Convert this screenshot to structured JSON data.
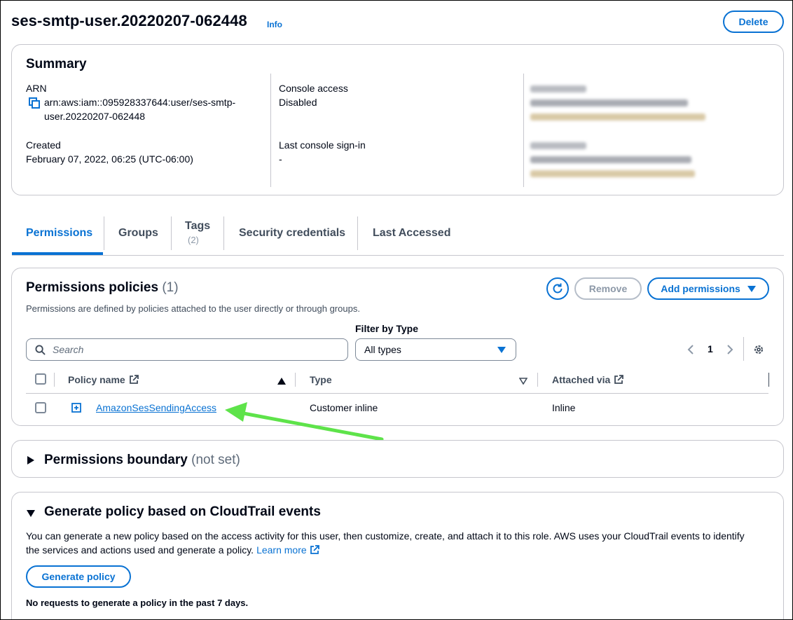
{
  "header": {
    "title": "ses-smtp-user.20220207-062448",
    "info_label": "Info",
    "delete_label": "Delete"
  },
  "summary": {
    "heading": "Summary",
    "arn_label": "ARN",
    "arn_value_line1": "arn:aws:iam::095928337644:user/ses-smtp-",
    "arn_value_line2": "user.20220207-062448",
    "created_label": "Created",
    "created_value": "February 07, 2022, 06:25 (UTC-06:00)",
    "console_access_label": "Console access",
    "console_access_value": "Disabled",
    "last_signin_label": "Last console sign-in",
    "last_signin_value": "-"
  },
  "tabs": [
    {
      "label": "Permissions",
      "active": true
    },
    {
      "label": "Groups"
    },
    {
      "label": "Tags",
      "count": "(2)"
    },
    {
      "label": "Security credentials"
    },
    {
      "label": "Last Accessed"
    }
  ],
  "policies": {
    "heading": "Permissions policies",
    "count": "(1)",
    "description": "Permissions are defined by policies attached to the user directly or through groups.",
    "remove_label": "Remove",
    "add_label": "Add permissions",
    "filter_label": "Filter by Type",
    "search_placeholder": "Search",
    "filter_value": "All types",
    "page_number": "1",
    "columns": {
      "policy_name": "Policy name",
      "type": "Type",
      "attached_via": "Attached via"
    },
    "rows": [
      {
        "name": "AmazonSesSendingAccess",
        "type": "Customer inline",
        "attached_via": "Inline"
      }
    ]
  },
  "boundary": {
    "heading": "Permissions boundary",
    "status": "(not set)"
  },
  "generate": {
    "heading": "Generate policy based on CloudTrail events",
    "description_line1": "You can generate a new policy based on the access activity for this user, then customize, create, and attach it to this role. AWS uses your CloudTrail events to identify",
    "description_line2": "the services and actions used and generate a policy.",
    "learn_more": "Learn more",
    "button_label": "Generate policy",
    "note": "No requests to generate a policy in the past 7 days."
  },
  "colors": {
    "accent": "#0972d3",
    "annotation_arrow": "#5ee34a",
    "border": "#c6c6cd"
  }
}
